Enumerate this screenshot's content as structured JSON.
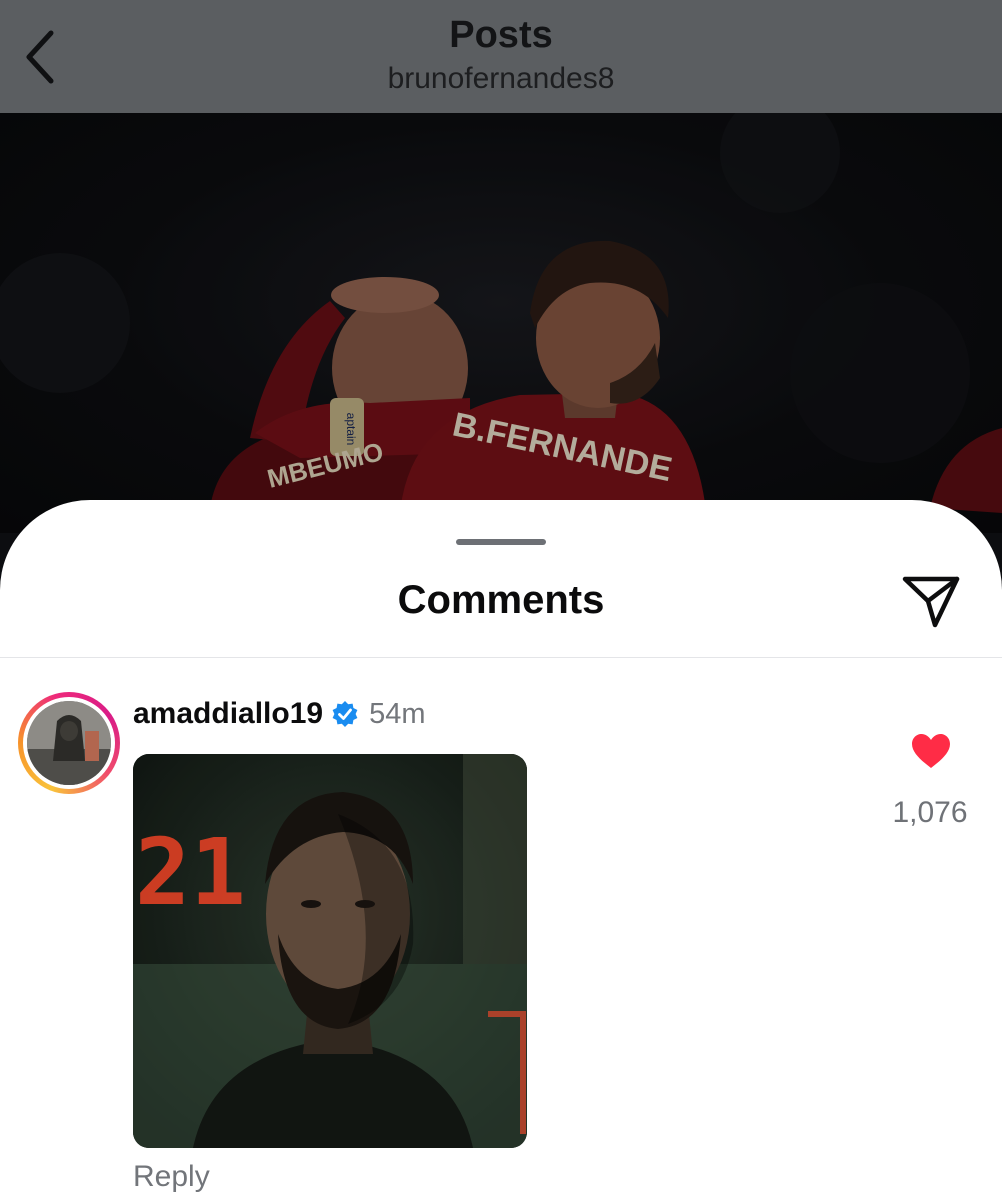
{
  "nav": {
    "title": "Posts",
    "subtitle": "brunofernandes8",
    "back_icon": "chevron-left-icon"
  },
  "post_photo": {
    "jersey_text_left": "MBEUMO",
    "jersey_text_right": "B.FERNANDE",
    "armband_text": "aptain"
  },
  "comments_sheet": {
    "title": "Comments",
    "share_icon": "paper-plane-icon"
  },
  "comment": {
    "username": "amaddiallo19",
    "verified_icon": "verified-badge-icon",
    "timestamp": "54m",
    "media_scoreboard_text": "21",
    "reply_label": "Reply",
    "like_icon": "heart-filled-icon",
    "like_count": "1,076"
  },
  "colors": {
    "like": "#ff2c46",
    "verified": "#1a8cf0",
    "secondary_text": "#73767b"
  }
}
